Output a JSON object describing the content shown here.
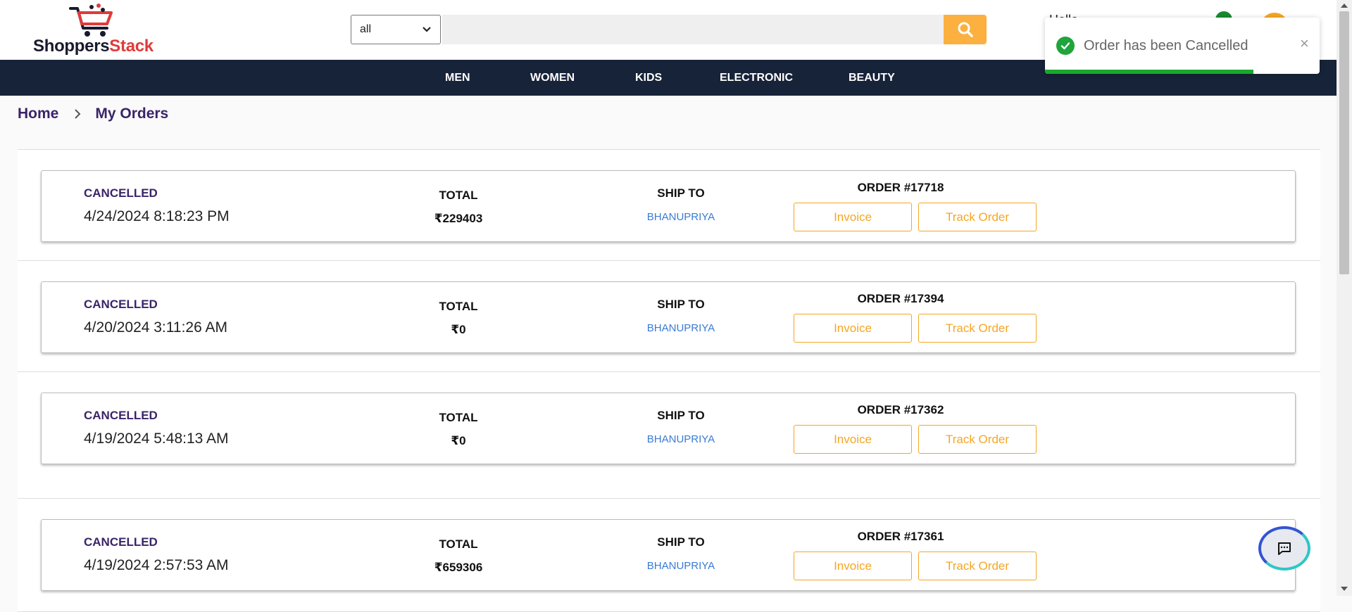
{
  "header": {
    "logo": {
      "part1": "Shoppers",
      "part2": "Stack"
    },
    "category_select": {
      "value": "all"
    },
    "search": {
      "placeholder": ""
    },
    "greeting": "Hello"
  },
  "nav": {
    "items": [
      "MEN",
      "WOMEN",
      "KIDS",
      "ELECTRONIC",
      "BEAUTY"
    ]
  },
  "breadcrumb": {
    "home": "Home",
    "current": "My Orders"
  },
  "column_labels": {
    "total": "TOTAL",
    "ship_to": "SHIP TO"
  },
  "orders": [
    {
      "status": "CANCELLED",
      "date": "4/24/2024 8:18:23 PM",
      "total": "₹229403",
      "ship_to": "BHANUPRIYA",
      "order_no": "ORDER #17718",
      "invoice": "Invoice",
      "track": "Track Order"
    },
    {
      "status": "CANCELLED",
      "date": "4/20/2024 3:11:26 AM",
      "total": "₹0",
      "ship_to": "BHANUPRIYA",
      "order_no": "ORDER #17394",
      "invoice": "Invoice",
      "track": "Track Order"
    },
    {
      "status": "CANCELLED",
      "date": "4/19/2024 5:48:13 AM",
      "total": "₹0",
      "ship_to": "BHANUPRIYA",
      "order_no": "ORDER #17362",
      "invoice": "Invoice",
      "track": "Track Order"
    },
    {
      "status": "CANCELLED",
      "date": "4/19/2024 2:57:53 AM",
      "total": "₹659306",
      "ship_to": "BHANUPRIYA",
      "order_no": "ORDER #17361",
      "invoice": "Invoice",
      "track": "Track Order"
    }
  ],
  "toast": {
    "message": "Order has been Cancelled",
    "close": "×",
    "progress": 0.76
  },
  "colors": {
    "nav_bg": "#172338",
    "accent": "#f5a623",
    "status": "#3a2468",
    "ship_to": "#3a7bd5",
    "success": "#1fa53b"
  }
}
